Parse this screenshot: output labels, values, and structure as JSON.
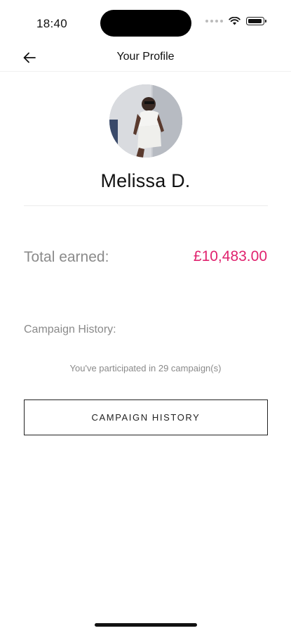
{
  "status_bar": {
    "time": "18:40"
  },
  "header": {
    "title": "Your Profile",
    "back_icon": "arrow-left-icon"
  },
  "profile": {
    "name": "Melissa D.",
    "avatar": "profile-photo"
  },
  "earnings": {
    "label": "Total earned:",
    "value": "£10,483.00",
    "accent_color": "#e0226e"
  },
  "campaigns": {
    "label": "Campaign History:",
    "participation_text": "You've participated in 29 campaign(s)",
    "button_label": "CAMPAIGN HISTORY"
  }
}
